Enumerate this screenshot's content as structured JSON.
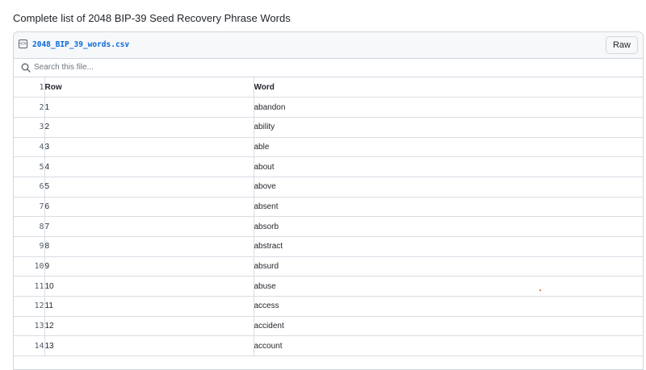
{
  "page": {
    "title": "Complete list of 2048 BIP-39 Seed Recovery Phrase Words"
  },
  "file": {
    "name": "2048_BIP_39_words.csv",
    "raw_label": "Raw",
    "icon": "code-file-icon"
  },
  "search": {
    "placeholder": "Search this file...",
    "value": "",
    "icon": "search-icon"
  },
  "table": {
    "header": {
      "line": "1",
      "columns": [
        "Row",
        "Word"
      ]
    },
    "rows": [
      {
        "line": "2",
        "row": "1",
        "word": "abandon"
      },
      {
        "line": "3",
        "row": "2",
        "word": "ability"
      },
      {
        "line": "4",
        "row": "3",
        "word": "able"
      },
      {
        "line": "5",
        "row": "4",
        "word": "about"
      },
      {
        "line": "6",
        "row": "5",
        "word": "above"
      },
      {
        "line": "7",
        "row": "6",
        "word": "absent"
      },
      {
        "line": "8",
        "row": "7",
        "word": "absorb"
      },
      {
        "line": "9",
        "row": "8",
        "word": "abstract"
      },
      {
        "line": "10",
        "row": "9",
        "word": "absurd"
      },
      {
        "line": "11",
        "row": "10",
        "word": "abuse"
      },
      {
        "line": "12",
        "row": "11",
        "word": "access"
      },
      {
        "line": "13",
        "row": "12",
        "word": "accident"
      },
      {
        "line": "14",
        "row": "13",
        "word": "account"
      }
    ]
  }
}
